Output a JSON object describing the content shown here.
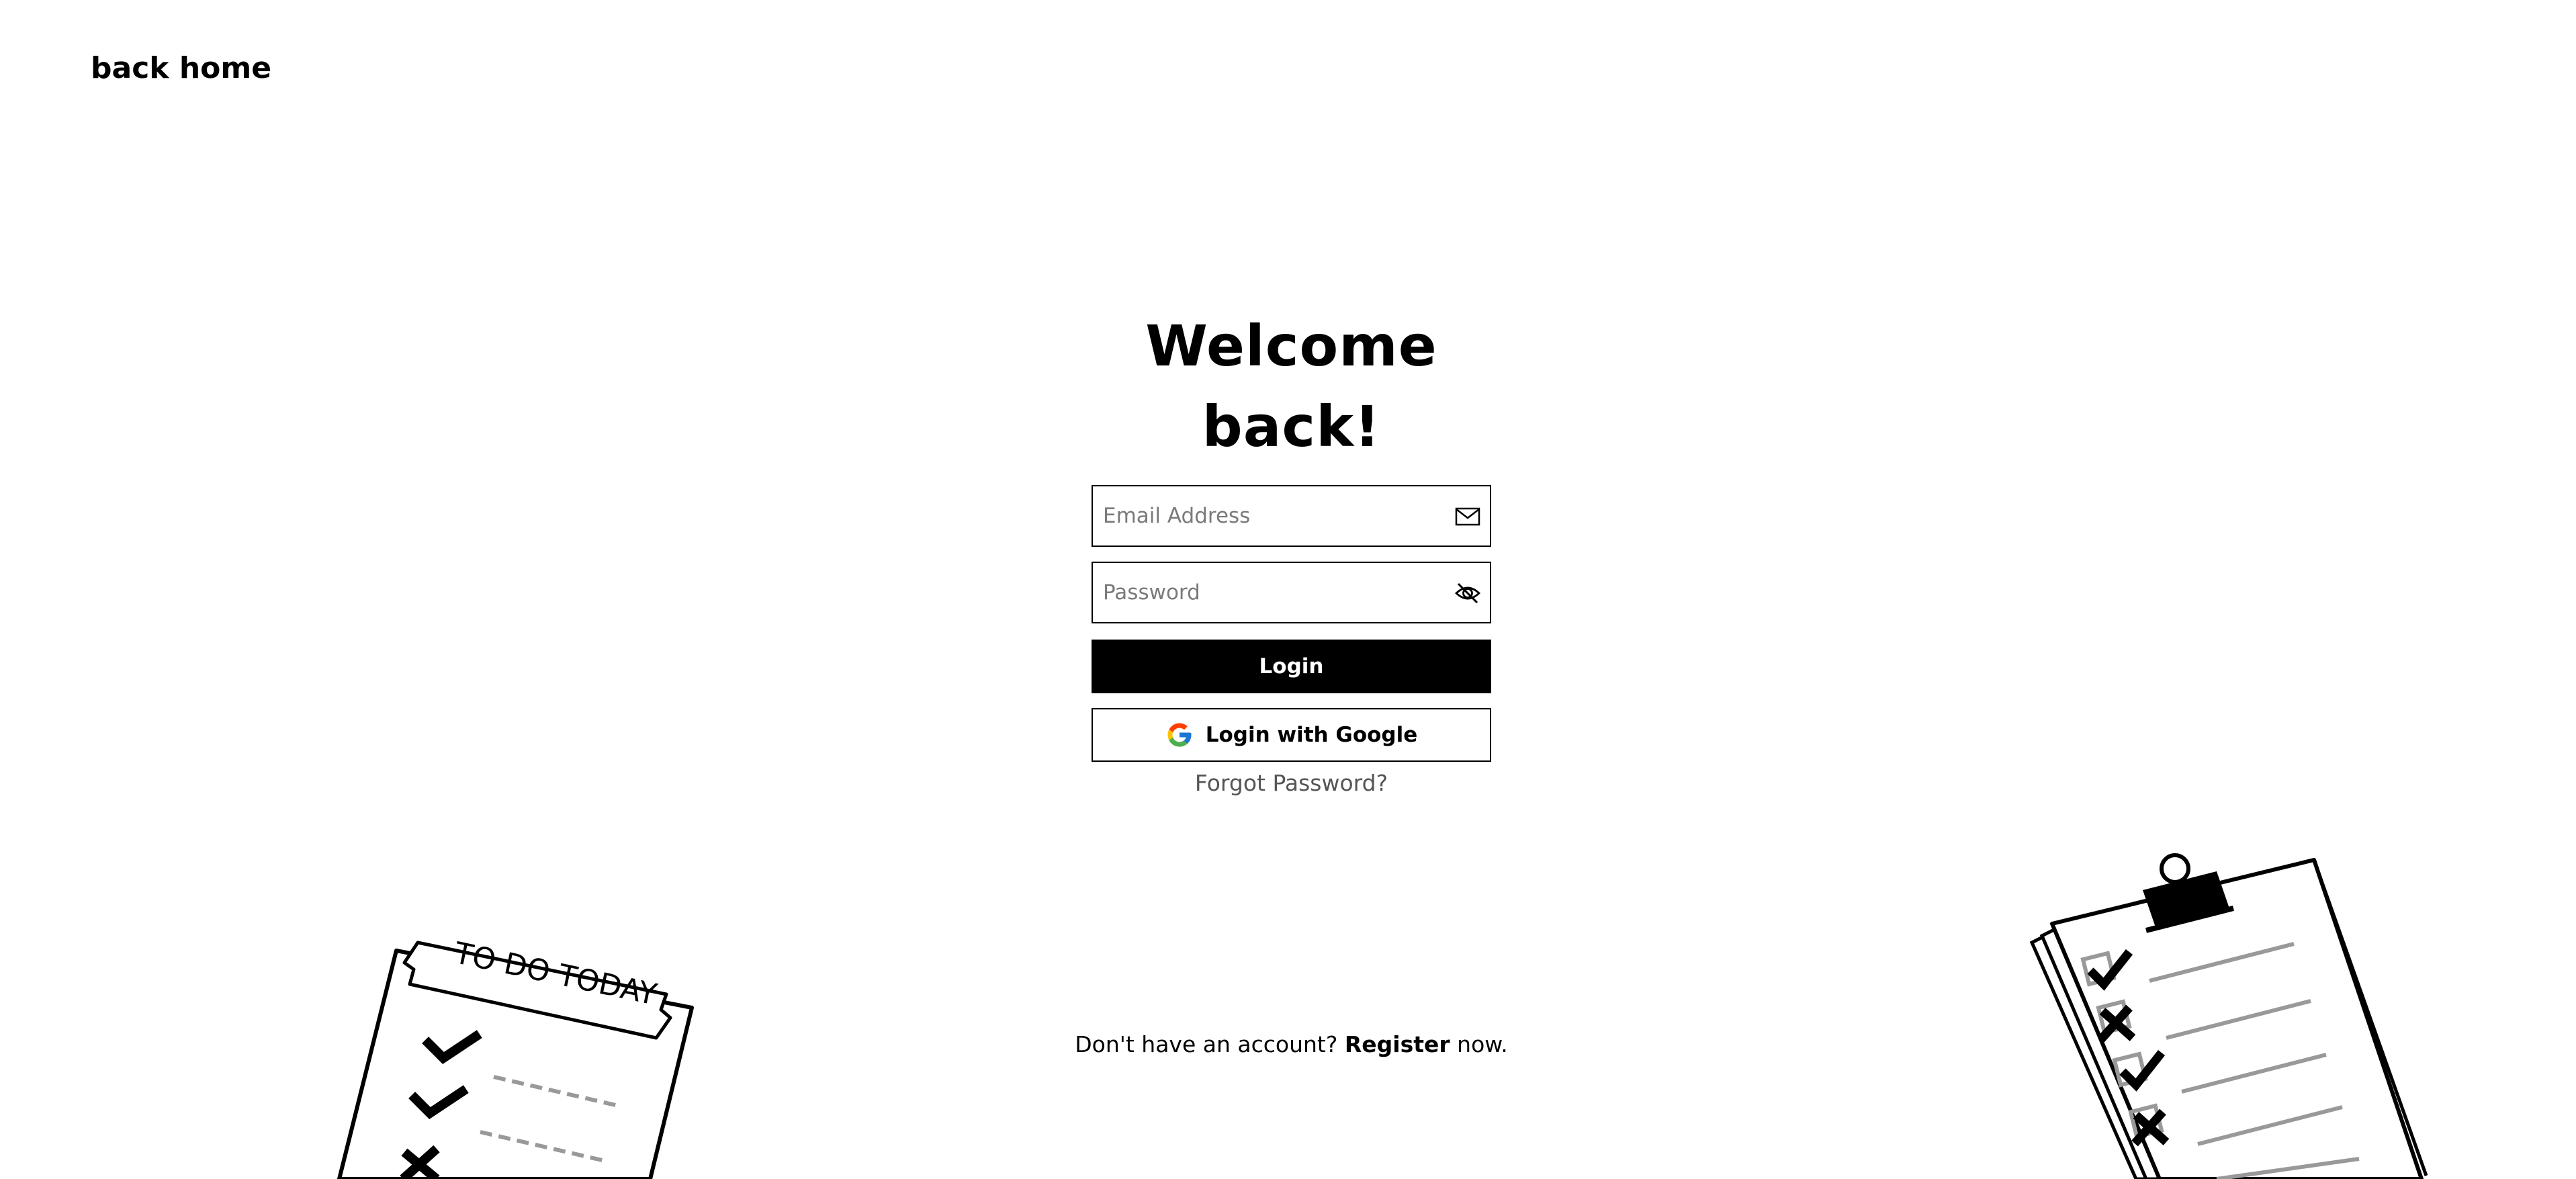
{
  "nav": {
    "back_home": "back home"
  },
  "form": {
    "title": "Welcome back!",
    "email_placeholder": "Email Address",
    "email_icon": "mail-icon",
    "password_placeholder": "Password",
    "password_icon": "eye-off-icon",
    "login_label": "Login",
    "google_login_label": "Login with Google",
    "google_icon": "google-icon",
    "forgot_label": "Forgot Password?"
  },
  "register": {
    "prefix": "Don't have an account?",
    "link": "Register",
    "suffix": "now."
  },
  "illustrations": {
    "left_banner_text": "TO DO TODAY",
    "left_icon": "todo-list-illustration",
    "right_icon": "clipboard-checklist-illustration"
  },
  "colors": {
    "primary": "#000000",
    "background": "#ffffff",
    "placeholder": "#7a7a7a",
    "muted_link": "#555555"
  }
}
